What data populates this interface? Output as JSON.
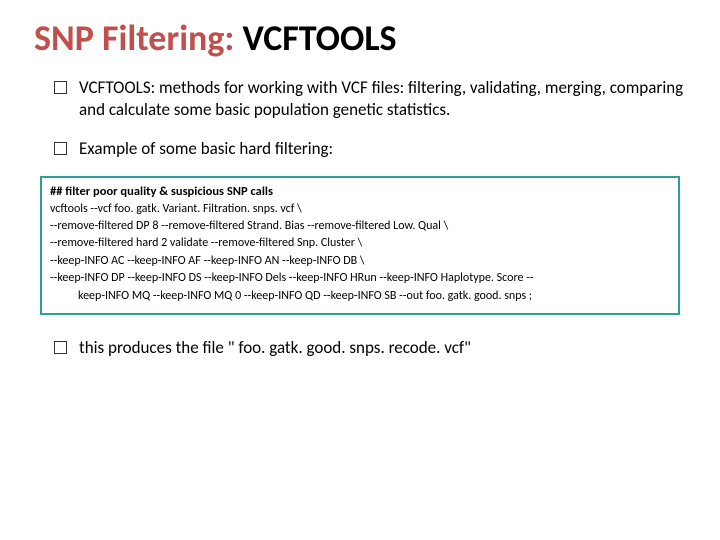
{
  "title": {
    "lead": "SNP Filtering: ",
    "tail": "VCFTOOLS"
  },
  "bullets": {
    "b1": "VCFTOOLS: methods for working with VCF files: filtering, validating, merging, comparing and calculate some basic population genetic statistics.",
    "b2": "Example of some basic hard filtering:",
    "b3": "this produces the file \" foo. gatk. good. snps. recode. vcf\""
  },
  "code": {
    "header": "## filter poor quality & suspicious SNP calls",
    "l1": "vcftools --vcf foo. gatk. Variant. Filtration. snps. vcf \\",
    "l2": "--remove-filtered  DP 8 --remove-filtered Strand. Bias --remove-filtered  Low. Qual \\",
    "l3": "--remove-filtered  hard 2 validate --remove-filtered  Snp. Cluster \\",
    "l4": "--keep-INFO AC --keep-INFO AF --keep-INFO AN --keep-INFO DB \\",
    "l5a": "--keep-INFO DP --keep-INFO DS --keep-INFO Dels --keep-INFO HRun --keep-INFO Haplotype. Score --",
    "l5b": "keep-INFO MQ --keep-INFO MQ 0 --keep-INFO QD --keep-INFO SB --out foo. gatk. good. snps ;"
  }
}
